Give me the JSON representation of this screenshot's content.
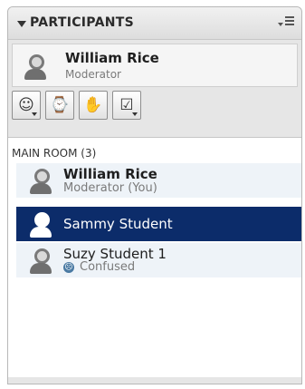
{
  "panel": {
    "title": "PARTICIPANTS"
  },
  "current_user": {
    "name": "William Rice",
    "role": "Moderator"
  },
  "toolbar": {
    "buttons": [
      {
        "icon": "smiley-status-icon"
      },
      {
        "icon": "user-away-icon"
      },
      {
        "icon": "raise-hand-icon"
      },
      {
        "icon": "checkbox-menu-icon"
      }
    ]
  },
  "room": {
    "label": "MAIN ROOM (3)",
    "participants": [
      {
        "name": "William Rice",
        "role": "Moderator (You)",
        "selected": false
      },
      {
        "name": "Sammy Student",
        "role": "",
        "selected": true
      },
      {
        "name": "Suzy Student 1",
        "status": "Confused",
        "status_icon": "confused-face-icon",
        "selected": false
      }
    ]
  },
  "colors": {
    "selection": "#0c2c6a",
    "row_bg": "#eef3f8",
    "panel_bg": "#e6e6e6"
  }
}
